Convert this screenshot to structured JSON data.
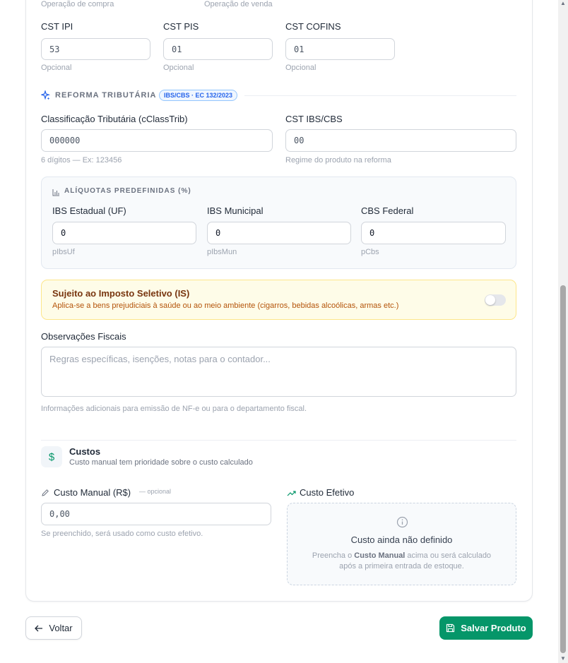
{
  "tax": {
    "top_hint_left": "Operação de compra",
    "top_hint_right": "Operação de venda",
    "cst_ipi": {
      "label": "CST IPI",
      "value": "53",
      "hint": "Opcional"
    },
    "cst_pis": {
      "label": "CST PIS",
      "value": "01",
      "hint": "Opcional"
    },
    "cst_cofins": {
      "label": "CST COFINS",
      "value": "01",
      "hint": "Opcional"
    }
  },
  "reforma": {
    "title": "REFORMA TRIBUTÁRIA",
    "badge": "IBS/CBS · EC 132/2023",
    "cclasstrib": {
      "label": "Classificação Tributária (cClassTrib)",
      "value": "000000",
      "hint": "6 dígitos — Ex: 123456"
    },
    "cst_ibs": {
      "label": "CST IBS/CBS",
      "value": "00",
      "hint": "Regime do produto na reforma"
    },
    "aliquotas": {
      "title": "ALÍQUOTAS PREDEFINIDAS (%)",
      "ibs_uf": {
        "label": "IBS Estadual (UF)",
        "value": "0",
        "hint": "pIbsUf"
      },
      "ibs_mun": {
        "label": "IBS Municipal",
        "value": "0",
        "hint": "pIbsMun"
      },
      "cbs": {
        "label": "CBS Federal",
        "value": "0",
        "hint": "pCbs"
      }
    },
    "imposto_seletivo": {
      "title": "Sujeito ao Imposto Seletivo (IS)",
      "description": "Aplica-se a bens prejudiciais à saúde ou ao meio ambiente (cigarros, bebidas alcoólicas, armas etc.)",
      "enabled": false
    },
    "observacoes": {
      "label": "Observações Fiscais",
      "placeholder": "Regras específicas, isenções, notas para o contador...",
      "hint": "Informações adicionais para emissão de NF-e ou para o departamento fiscal."
    }
  },
  "custos": {
    "title": "Custos",
    "subtitle": "Custo manual tem prioridade sobre o custo calculado",
    "manual": {
      "label": "Custo Manual (R$)",
      "optional": "— opcional",
      "value": "0,00",
      "hint": "Se preenchido, será usado como custo efetivo."
    },
    "efetivo": {
      "label": "Custo Efetivo",
      "empty_title": "Custo ainda não definido",
      "empty_pre": "Preencha o ",
      "empty_bold": "Custo Manual",
      "empty_post": " acima ou será calculado",
      "empty_line2": "após a primeira entrada de estoque."
    }
  },
  "footer": {
    "back_label": "Voltar",
    "save_label": "Salvar Produto"
  },
  "colors": {
    "primary": "#059669",
    "badge_blue": "#2563eb",
    "warning_bg": "#fefce8",
    "warning_text": "#92400e"
  }
}
